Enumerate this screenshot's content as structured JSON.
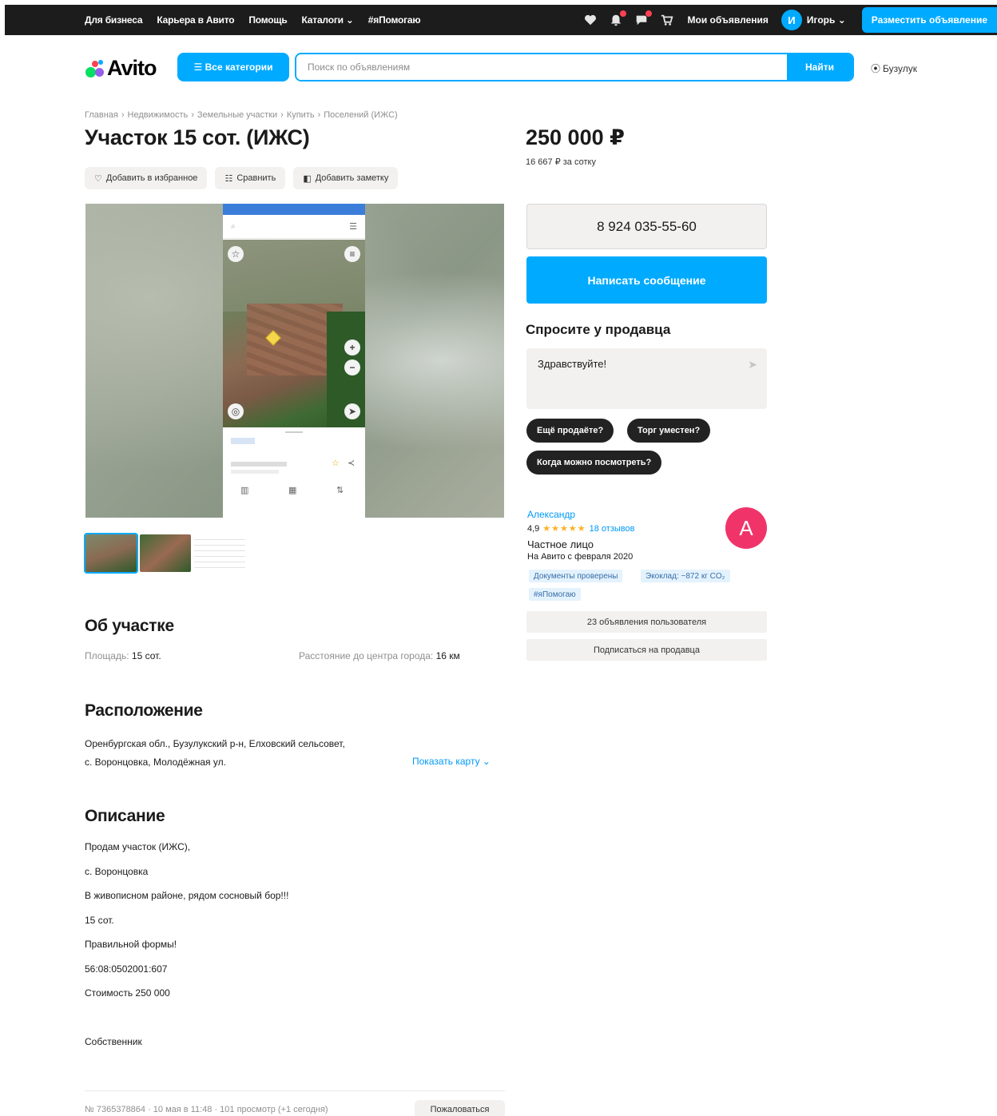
{
  "topbar": {
    "nav": [
      "Для бизнеса",
      "Карьера в Авито",
      "Помощь",
      "Каталоги ⌄",
      "#яПомогаю"
    ],
    "icons": [
      "heart-icon",
      "bell-icon",
      "chat-icon",
      "cart-icon"
    ],
    "my_ads": "Мои объявления",
    "user_initial": "И",
    "user_name": "Игорь ⌄",
    "post_ad": "Разместить объявление",
    "accent": "#00aaff",
    "badge_color": "#ff4053"
  },
  "header": {
    "logo": "Avito",
    "all_categories": "☰ Все категории",
    "search_placeholder": "Поиск по объявлениям",
    "search_button": "Найти",
    "location": "Бузулук"
  },
  "breadcrumb": [
    "Главная",
    "Недвижимость",
    "Земельные участки",
    "Купить",
    "Поселений (ИЖС)"
  ],
  "listing": {
    "title": "Участок 15 сот. (ИЖС)",
    "actions": {
      "favorite": "Добавить в избранное",
      "compare": "Сравнить",
      "note": "Добавить заметку"
    }
  },
  "about": {
    "heading": "Об участке",
    "area_label": "Площадь:",
    "area_value": "15 сот.",
    "distance_label": "Расстояние до центра города:",
    "distance_value": "16 км"
  },
  "location_section": {
    "heading": "Расположение",
    "line1": "Оренбургская обл., Бузулукский р-н, Елховский сельсовет,",
    "line2": "с. Воронцовка, Молодёжная ул.",
    "show_map": "Показать карту ⌄"
  },
  "description": {
    "heading": "Описание",
    "lines": [
      "Продам участок (ИЖС),",
      "с. Воронцовка",
      "В живописном районе, рядом сосновый бор!!!",
      "15 сот.",
      "Правильной формы!",
      "56:08:0502001:607",
      "Стоимость 250 000",
      "Собственник"
    ]
  },
  "footer": {
    "meta": "№ 7365378864 · 10 мая в 11:48 · 101 просмотр (+1 сегодня)",
    "report": "Пожаловаться"
  },
  "sidebar": {
    "price": "250 000 ₽",
    "price_per_unit": "16 667 ₽ за сотку",
    "phone": "8 924 035-55-60",
    "message_button": "Написать сообщение",
    "ask_heading": "Спросите у продавца",
    "ask_value": "Здравствуйте!",
    "chips": [
      "Ещё продаёте?",
      "Торг уместен?",
      "Когда можно посмотреть?"
    ],
    "seller": {
      "name": "Александр",
      "rating": "4,9",
      "stars": "★★★★★",
      "reviews": "18 отзывов",
      "type": "Частное лицо",
      "since": "На Авито с февраля 2020",
      "avatar_letter": "A",
      "avatar_color": "#f0346a",
      "badges": [
        "Документы проверены",
        "Экоклад: −872 кг CO₂",
        "#яПомогаю"
      ],
      "ads_count": "23 объявления пользователя",
      "subscribe": "Подписаться на продавца"
    }
  }
}
